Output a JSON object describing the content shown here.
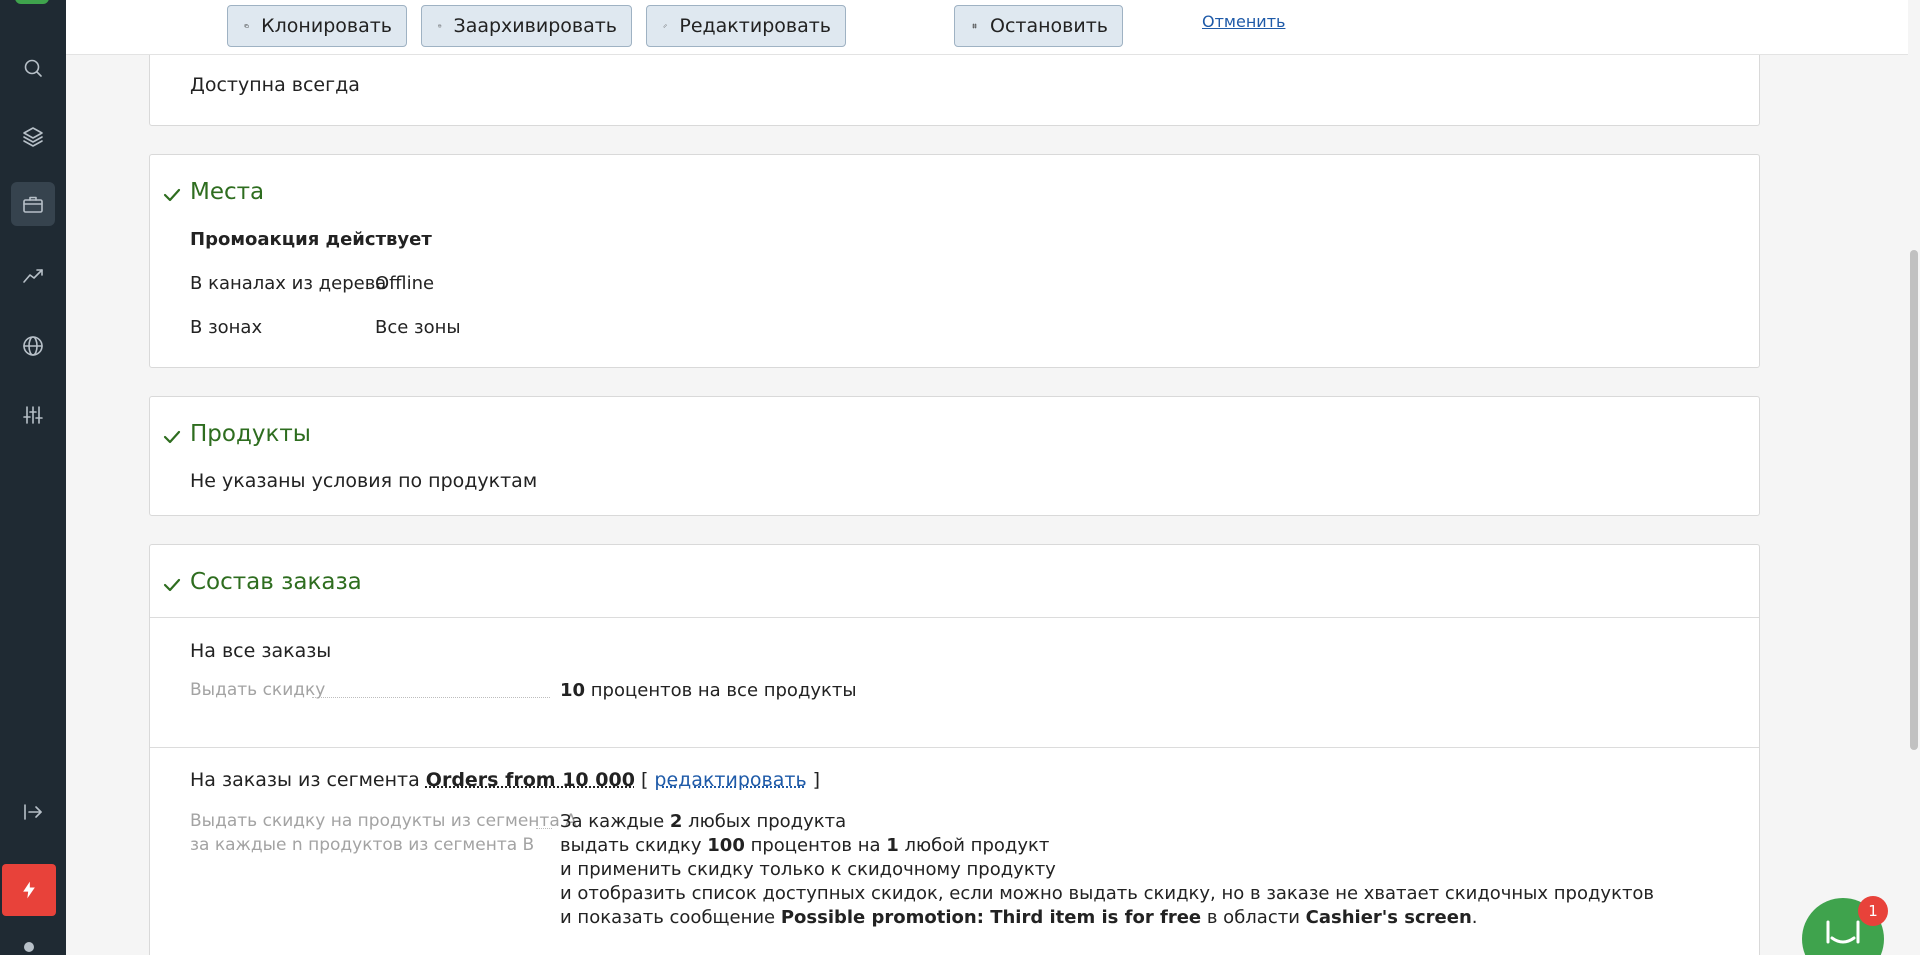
{
  "toolbar": {
    "clone_label": "Клонировать",
    "archive_label": "Заархивировать",
    "edit_label": "Редактировать",
    "stop_label": "Остановить",
    "cancel_link": "Отменить"
  },
  "availability": {
    "text": "Доступна всегда"
  },
  "places": {
    "title": "Места",
    "subtitle": "Промоакция действует",
    "rows": [
      {
        "label": "В каналах из дерева",
        "value": "Offline"
      },
      {
        "label": "В зонах",
        "value": "Все зоны"
      }
    ]
  },
  "products": {
    "title": "Продукты",
    "text": "Не указаны условия по продуктам"
  },
  "order": {
    "title": "Состав заказа",
    "all_orders": {
      "heading": "На все заказы",
      "label": "Выдать скидку",
      "value_bold": "10",
      "value_rest": " процентов на все продукты"
    },
    "segment": {
      "heading_prefix": "На заказы из сегмента ",
      "segment_name": "Orders from 10 000",
      "bracket_open": " [ ",
      "edit_link": "редактировать",
      "bracket_close": " ]",
      "label_line1": "Выдать скидку на продукты из сегмента А",
      "label_line2": "за каждые n продуктов из сегмента В",
      "line1_a": "За каждые ",
      "line1_b": "2",
      "line1_c": " любых продукта",
      "line2_a": "выдать скидку ",
      "line2_b": "100",
      "line2_c": " процентов на ",
      "line2_d": "1",
      "line2_e": " любой продукт",
      "line3": "и применить скидку только к скидочному продукту",
      "line4": "и отобразить список доступных скидок, если можно выдать скидку, но в заказе не хватает скидочных продуктов",
      "line5_a": "и показать сообщение ",
      "line5_b": "Possible promotion: Third item is for free",
      "line5_c": " в области ",
      "line5_d": "Cashier's screen",
      "line5_e": "."
    }
  },
  "chat": {
    "badge": "1"
  },
  "colors": {
    "sidebar": "#1f2a33",
    "accent_green": "#2e6d1f",
    "button_bg": "#dfe8f0",
    "danger": "#e8423a"
  }
}
